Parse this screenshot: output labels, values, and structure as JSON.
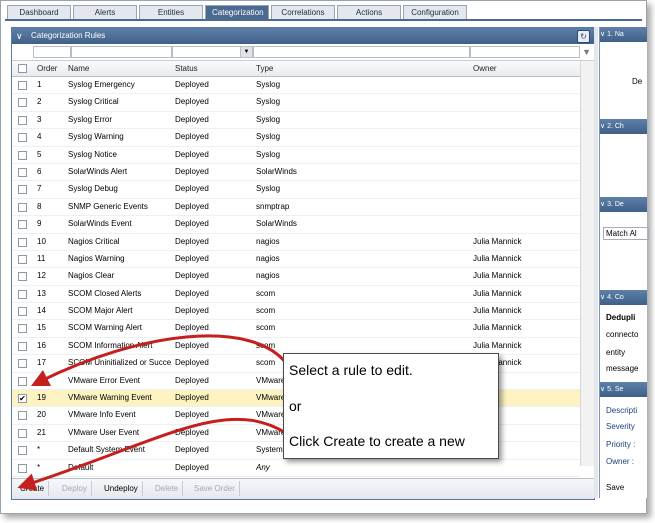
{
  "tabs": [
    "Dashboard",
    "Alerts",
    "Entities",
    "Categorization",
    "Correlations",
    "Actions",
    "Configuration"
  ],
  "active_tab": "Categorization",
  "panel": {
    "title": "Categorization Rules"
  },
  "columns": {
    "order": "Order",
    "name": "Name",
    "status": "Status",
    "type": "Type",
    "owner": "Owner"
  },
  "rows": [
    {
      "order": "1",
      "name": "Syslog Emergency",
      "status": "Deployed",
      "type": "Syslog",
      "owner": "",
      "checked": false
    },
    {
      "order": "2",
      "name": "Syslog Critical",
      "status": "Deployed",
      "type": "Syslog",
      "owner": "",
      "checked": false
    },
    {
      "order": "3",
      "name": "Syslog Error",
      "status": "Deployed",
      "type": "Syslog",
      "owner": "",
      "checked": false
    },
    {
      "order": "4",
      "name": "Syslog Warning",
      "status": "Deployed",
      "type": "Syslog",
      "owner": "",
      "checked": false
    },
    {
      "order": "5",
      "name": "Syslog Notice",
      "status": "Deployed",
      "type": "Syslog",
      "owner": "",
      "checked": false
    },
    {
      "order": "6",
      "name": "SolarWinds Alert",
      "status": "Deployed",
      "type": "SolarWinds",
      "owner": "",
      "checked": false
    },
    {
      "order": "7",
      "name": "Syslog Debug",
      "status": "Deployed",
      "type": "Syslog",
      "owner": "",
      "checked": false
    },
    {
      "order": "8",
      "name": "SNMP Generic Events",
      "status": "Deployed",
      "type": "snmptrap",
      "owner": "",
      "checked": false
    },
    {
      "order": "9",
      "name": "SolarWinds Event",
      "status": "Deployed",
      "type": "SolarWinds",
      "owner": "",
      "checked": false
    },
    {
      "order": "10",
      "name": "Nagios Critical",
      "status": "Deployed",
      "type": "nagios",
      "owner": "Julia Mannick",
      "checked": false
    },
    {
      "order": "11",
      "name": "Nagios Warning",
      "status": "Deployed",
      "type": "nagios",
      "owner": "Julia Mannick",
      "checked": false
    },
    {
      "order": "12",
      "name": "Nagios Clear",
      "status": "Deployed",
      "type": "nagios",
      "owner": "Julia Mannick",
      "checked": false
    },
    {
      "order": "13",
      "name": "SCOM Closed Alerts",
      "status": "Deployed",
      "type": "scom",
      "owner": "Julia Mannick",
      "checked": false
    },
    {
      "order": "14",
      "name": "SCOM Major Alert",
      "status": "Deployed",
      "type": "scom",
      "owner": "Julia Mannick",
      "checked": false
    },
    {
      "order": "15",
      "name": "SCOM Warning Alert",
      "status": "Deployed",
      "type": "scom",
      "owner": "Julia Mannick",
      "checked": false
    },
    {
      "order": "16",
      "name": "SCOM Information Alert",
      "status": "Deployed",
      "type": "scom",
      "owner": "Julia Mannick",
      "checked": false
    },
    {
      "order": "17",
      "name": "SCOM Uninitialized or Succe",
      "status": "Deployed",
      "type": "scom",
      "owner": "Julia Mannick",
      "checked": false
    },
    {
      "order": "18",
      "name": "VMware Error Event",
      "status": "Deployed",
      "type": "VMware",
      "owner": "",
      "checked": false
    },
    {
      "order": "19",
      "name": "VMware Warning Event",
      "status": "Deployed",
      "type": "VMware",
      "owner": "",
      "checked": true
    },
    {
      "order": "20",
      "name": "VMware Info Event",
      "status": "Deployed",
      "type": "VMware",
      "owner": "",
      "checked": false
    },
    {
      "order": "21",
      "name": "VMware User Event",
      "status": "Deployed",
      "type": "VMware",
      "owner": "",
      "checked": false
    },
    {
      "order": "*",
      "name": "Default System Event",
      "status": "Deployed",
      "type": "System",
      "owner": "",
      "checked": false
    },
    {
      "order": "*",
      "name": "Default",
      "status": "Deployed",
      "type": "Any",
      "owner": "",
      "checked": false
    }
  ],
  "footer": {
    "create": "Create",
    "deploy": "Deploy",
    "undeploy": "Undeploy",
    "delete": "Delete",
    "save_order": "Save Order"
  },
  "right_panel": {
    "sections": [
      "1. Na",
      "2. Ch",
      "3. De",
      "4. Co",
      "5. Se"
    ],
    "de_label": "De",
    "match_all": "Match Al",
    "dedup": "Dedupli",
    "connector": "connecto",
    "entity": "entity",
    "message": "message",
    "description": "Descripti",
    "severity": "Severity",
    "priority": "Priority :",
    "owner": "Owner :",
    "save": "Save"
  },
  "callout": {
    "line1": "Select a rule to edit.",
    "line2": "or",
    "line3": "Click Create to create a new"
  },
  "colors": {
    "header_blue": "#4b6a8f",
    "selected_row": "#fdf2c2",
    "arrow_red": "#c42020"
  }
}
